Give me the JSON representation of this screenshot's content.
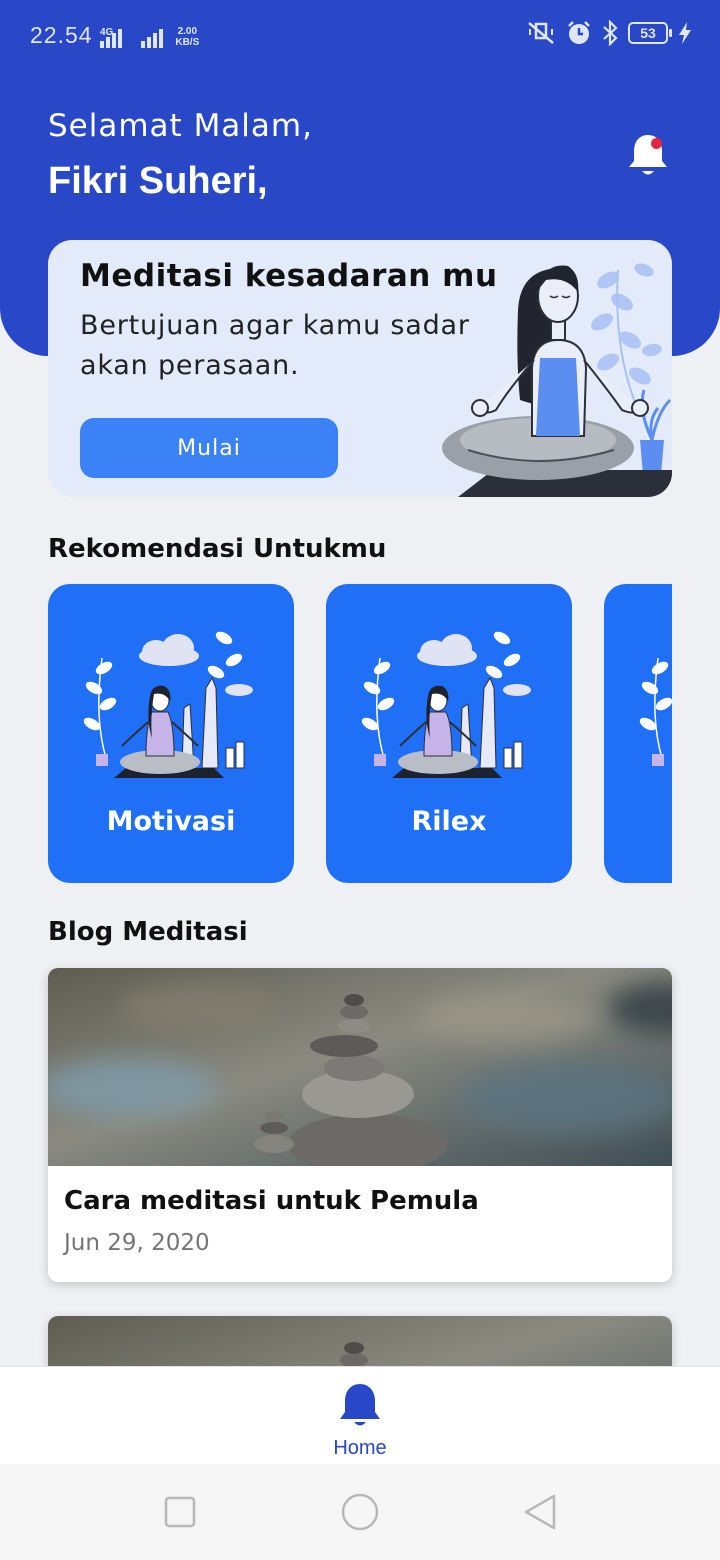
{
  "status_bar": {
    "time": "22.54",
    "network_label": "4G",
    "speed_value": "2.00",
    "speed_unit": "KB/S",
    "battery_level": "53",
    "icons": [
      "mute-icon",
      "alarm-icon",
      "bluetooth-icon",
      "battery-icon",
      "charging-icon"
    ]
  },
  "header": {
    "greeting": "Selamat Malam,",
    "user_name": "Fikri Suheri,",
    "notification_icon": "bell-icon",
    "has_unread": true
  },
  "hero": {
    "title": "Meditasi kesadaran mu",
    "description": "Bertujuan agar kamu sadar akan perasaan.",
    "button_label": "Mulai",
    "illustration": "meditating-woman-illustration"
  },
  "recommendations": {
    "title": "Rekomendasi Untukmu",
    "items": [
      {
        "label": "Motivasi",
        "illustration": "meditation-illustration"
      },
      {
        "label": "Rilex",
        "illustration": "meditation-illustration"
      },
      {
        "label": "",
        "illustration": "meditation-illustration"
      }
    ]
  },
  "blog": {
    "title": "Blog Meditasi",
    "posts": [
      {
        "title": "Cara meditasi untuk Pemula",
        "date": "Jun 29, 2020",
        "image": "stacked-stones-photo"
      },
      {
        "title": "",
        "date": "",
        "image": "stacked-stones-photo"
      }
    ]
  },
  "bottom_nav": {
    "items": [
      {
        "label": "Home",
        "icon": "bell-icon",
        "active": true
      }
    ]
  },
  "system_nav": {
    "buttons": [
      "recents-button",
      "home-button",
      "back-button"
    ]
  },
  "colors": {
    "primary": "#2848c8",
    "card_blue": "#1f6ff7",
    "button_blue": "#3b82f6",
    "hero_bg": "#e3ebfb",
    "page_bg": "#eef0f3",
    "badge_red": "#e8253f"
  }
}
